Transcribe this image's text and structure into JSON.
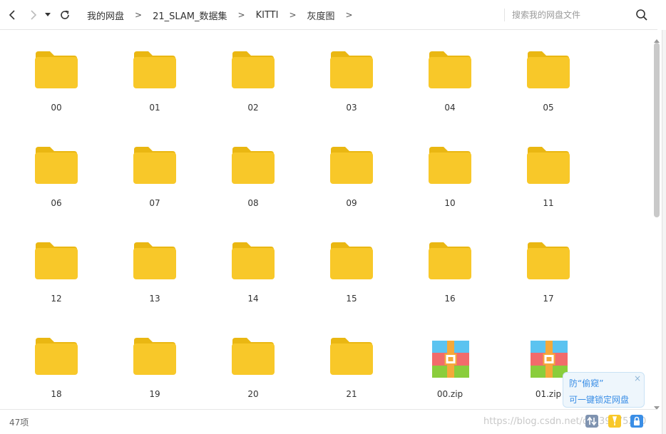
{
  "toolbar": {
    "back_icon": "chevron-left-icon",
    "forward_icon": "chevron-right-icon",
    "history_icon": "caret-down-icon",
    "refresh_icon": "refresh-icon"
  },
  "breadcrumb": {
    "items": [
      "我的网盘",
      "21_SLAM_数据集",
      "KITTI",
      "灰度图"
    ],
    "separator": ">"
  },
  "search": {
    "placeholder": "搜索我的网盘文件",
    "icon": "search-icon"
  },
  "files": [
    {
      "name": "00",
      "type": "folder"
    },
    {
      "name": "01",
      "type": "folder"
    },
    {
      "name": "02",
      "type": "folder"
    },
    {
      "name": "03",
      "type": "folder"
    },
    {
      "name": "04",
      "type": "folder"
    },
    {
      "name": "05",
      "type": "folder"
    },
    {
      "name": "06",
      "type": "folder"
    },
    {
      "name": "07",
      "type": "folder"
    },
    {
      "name": "08",
      "type": "folder"
    },
    {
      "name": "09",
      "type": "folder"
    },
    {
      "name": "10",
      "type": "folder"
    },
    {
      "name": "11",
      "type": "folder"
    },
    {
      "name": "12",
      "type": "folder"
    },
    {
      "name": "13",
      "type": "folder"
    },
    {
      "name": "14",
      "type": "folder"
    },
    {
      "name": "15",
      "type": "folder"
    },
    {
      "name": "16",
      "type": "folder"
    },
    {
      "name": "17",
      "type": "folder"
    },
    {
      "name": "18",
      "type": "folder"
    },
    {
      "name": "19",
      "type": "folder"
    },
    {
      "name": "20",
      "type": "folder"
    },
    {
      "name": "21",
      "type": "folder"
    },
    {
      "name": "00.zip",
      "type": "zip"
    },
    {
      "name": "01.zip",
      "type": "zip"
    }
  ],
  "colors": {
    "folder_back": "#eab712",
    "folder_front": "#f8c829",
    "zip_top": "#5bc3f0",
    "zip_middle": "#f26b6b",
    "zip_bottom": "#8acd3c",
    "zip_strap": "#f4a93a",
    "accent": "#3a8ee6"
  },
  "status": {
    "item_count": "47项"
  },
  "watermark": "https://blog.csdn.net/qq_39775280",
  "popup": {
    "title": "防“偷窥”",
    "link": "可一键锁定网盘",
    "close_label": "×"
  },
  "tray_icons": [
    "transfer-icon",
    "file-icon",
    "lock-icon"
  ]
}
